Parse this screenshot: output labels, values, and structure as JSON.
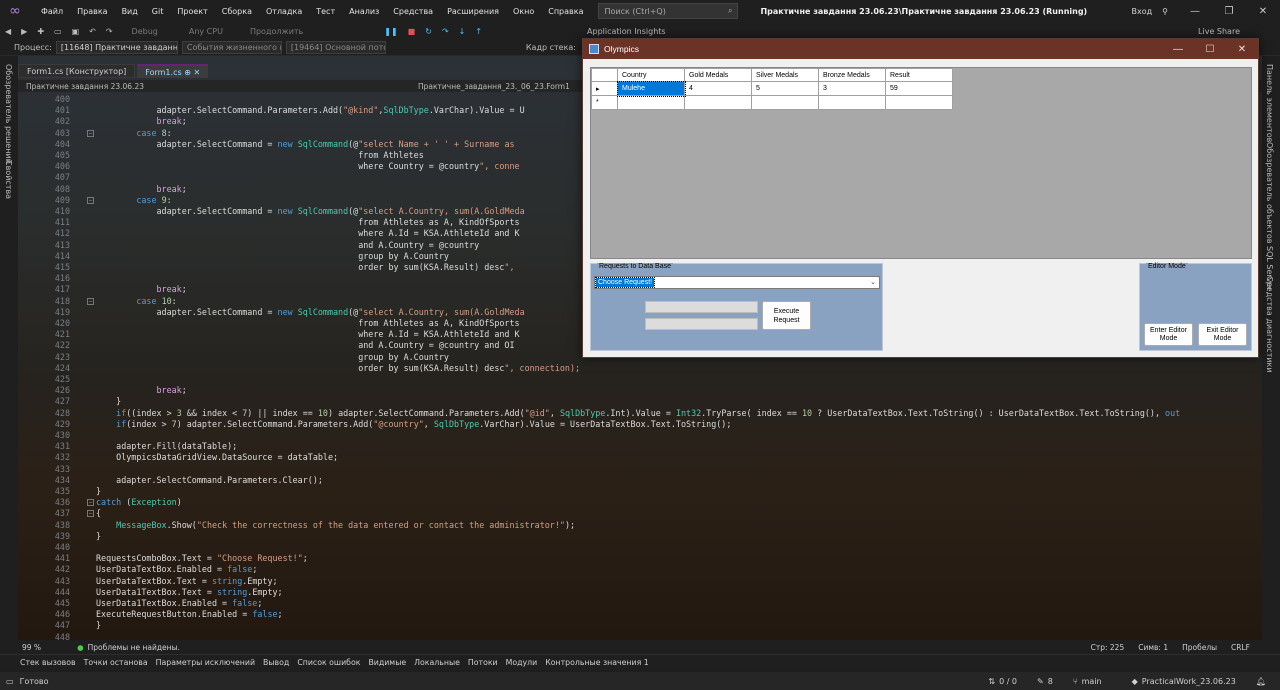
{
  "menu": {
    "items": [
      "Файл",
      "Правка",
      "Вид",
      "Git",
      "Проект",
      "Сборка",
      "Отладка",
      "Тест",
      "Анализ",
      "Средства",
      "Расширения",
      "Окно",
      "Справка"
    ],
    "search_placeholder": "Поиск (Ctrl+Q)",
    "solution_title": "Практичне завдання 23.06.23\\Практичне завдання 23.06.23 (Running)",
    "login": "Вход"
  },
  "toolbar": {
    "debug": "Debug",
    "cpu": "Any CPU",
    "continue": "Продолжить",
    "insights": "Application Insights",
    "live_share": "Live Share"
  },
  "process_bar": {
    "label": "Процесс:",
    "process": "[11648] Практичне завдання 23.06",
    "events": "События жизненного цикла",
    "thread": "[19464] Основной поток",
    "stack_label": "Кадр стека:"
  },
  "side_tabs": {
    "left": [
      "Обозреватель решений",
      "Свойства"
    ],
    "right": [
      "Панель элементов",
      "Обозреватель объектов SQL Server",
      "Средства диагностики"
    ]
  },
  "editor": {
    "tabs": [
      "Form1.cs [Конструктор]",
      "Form1.cs"
    ],
    "nav": [
      "Практичне завдання 23.06.23",
      "Практичне_завдання_23._06_23.Form1"
    ],
    "lines": [
      {
        "n": "400",
        "t": ""
      },
      {
        "n": "401",
        "t": "            adapter.SelectCommand.Parameters.Add(\"@kind\",SqlDbType.VarChar).Value = U"
      },
      {
        "n": "402",
        "t": "            break;"
      },
      {
        "n": "403",
        "t": "        case 8:"
      },
      {
        "n": "404",
        "t": "            adapter.SelectCommand = new SqlCommand(@\"select Name + ' ' + Surname as"
      },
      {
        "n": "405",
        "t": "                                                    from Athletes"
      },
      {
        "n": "406",
        "t": "                                                    where Country = @country\", conne"
      },
      {
        "n": "407",
        "t": ""
      },
      {
        "n": "408",
        "t": "            break;"
      },
      {
        "n": "409",
        "t": "        case 9:"
      },
      {
        "n": "410",
        "t": "            adapter.SelectCommand = new SqlCommand(@\"select A.Country, sum(A.GoldMeda"
      },
      {
        "n": "411",
        "t": "                                                    from Athletes as A, KindOfSports"
      },
      {
        "n": "412",
        "t": "                                                    where A.Id = KSA.AthleteId and K"
      },
      {
        "n": "413",
        "t": "                                                    and A.Country = @country"
      },
      {
        "n": "414",
        "t": "                                                    group by A.Country"
      },
      {
        "n": "415",
        "t": "                                                    order by sum(KSA.Result) desc\","
      },
      {
        "n": "416",
        "t": ""
      },
      {
        "n": "417",
        "t": "            break;"
      },
      {
        "n": "418",
        "t": "        case 10:"
      },
      {
        "n": "419",
        "t": "            adapter.SelectCommand = new SqlCommand(@\"select A.Country, sum(A.GoldMeda"
      },
      {
        "n": "420",
        "t": "                                                    from Athletes as A, KindOfSports"
      },
      {
        "n": "421",
        "t": "                                                    where A.Id = KSA.AthleteId and K"
      },
      {
        "n": "422",
        "t": "                                                    and A.Country = @country and OI"
      },
      {
        "n": "423",
        "t": "                                                    group by A.Country"
      },
      {
        "n": "424",
        "t": "                                                    order by sum(KSA.Result) desc\", connection);"
      },
      {
        "n": "425",
        "t": ""
      },
      {
        "n": "426",
        "t": "            break;"
      },
      {
        "n": "427",
        "t": "    }"
      },
      {
        "n": "428",
        "t": "    if((index > 3 && index < 7) || index == 10) adapter.SelectCommand.Parameters.Add(\"@id\", SqlDbType.Int).Value = Int32.TryParse( index == 10 ? UserDataTextBox.Text.ToString() : UserDataTextBox.Text.ToString(), out"
      },
      {
        "n": "429",
        "t": "    if(index > 7) adapter.SelectCommand.Parameters.Add(\"@country\", SqlDbType.VarChar).Value = UserDataTextBox.Text.ToString();"
      },
      {
        "n": "430",
        "t": ""
      },
      {
        "n": "431",
        "t": "    adapter.Fill(dataTable);"
      },
      {
        "n": "432",
        "t": "    OlympicsDataGridView.DataSource = dataTable;"
      },
      {
        "n": "433",
        "t": ""
      },
      {
        "n": "434",
        "t": "    adapter.SelectCommand.Parameters.Clear();"
      },
      {
        "n": "435",
        "t": "}"
      },
      {
        "n": "436",
        "t": "catch (Exception)"
      },
      {
        "n": "437",
        "t": "{"
      },
      {
        "n": "438",
        "t": "    MessageBox.Show(\"Check the correctness of the data entered or contact the administrator!\");"
      },
      {
        "n": "439",
        "t": "}"
      },
      {
        "n": "440",
        "t": ""
      },
      {
        "n": "441",
        "t": "RequestsComboBox.Text = \"Choose Request!\";"
      },
      {
        "n": "442",
        "t": "UserDataTextBox.Enabled = false;"
      },
      {
        "n": "443",
        "t": "UserDataTextBox.Text = string.Empty;"
      },
      {
        "n": "444",
        "t": "UserData1TextBox.Text = string.Empty;"
      },
      {
        "n": "445",
        "t": "UserData1TextBox.Enabled = false;"
      },
      {
        "n": "446",
        "t": "ExecuteRequestButton.Enabled = false;"
      },
      {
        "n": "447",
        "t": "}"
      },
      {
        "n": "448",
        "t": ""
      }
    ],
    "zoom": "99 %",
    "problems": "Проблемы не найдены.",
    "line_info": "Стр: 225",
    "col_info": "Симв: 1",
    "spaces": "Пробелы",
    "eol": "CRLF"
  },
  "bottom_tabs": [
    "Стек вызовов",
    "Точки останова",
    "Параметры исключений",
    "Вывод",
    "Список ошибок",
    "Видимые",
    "Локальные",
    "Потоки",
    "Модули",
    "Контрольные значения 1"
  ],
  "status": {
    "ready": "Готово",
    "git_changes": "0 / 0",
    "commits": "8",
    "branch": "main",
    "repo": "PracticalWork_23.06.23"
  },
  "olympics": {
    "title": "Olympics",
    "grid": {
      "columns": [
        "Country",
        "Gold Medals",
        "Silver Medals",
        "Bronze Medals",
        "Result"
      ],
      "rows": [
        [
          "Mulehe",
          "4",
          "5",
          "3",
          "59"
        ]
      ]
    },
    "requests_legend": "Requests to Data Base",
    "combo_value": "Choose Request!",
    "execute_label": "Execute Request",
    "editor_legend": "Editor Mode",
    "enter_editor": "Enter Editor Mode",
    "exit_editor": "Exit Editor Mode"
  }
}
